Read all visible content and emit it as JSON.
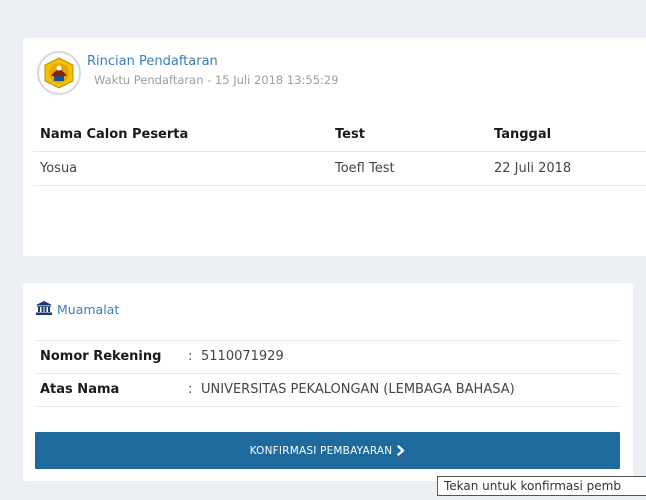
{
  "registration": {
    "title": "Rincian Pendaftaran",
    "time_text": "Waktu Pendaftaran - 15 Juli 2018 13:55:29",
    "columns": [
      "Nama Calon Peserta",
      "Test",
      "Tanggal"
    ],
    "rows": [
      [
        "Yosua",
        "Toefl Test",
        "22 Juli 2018"
      ]
    ]
  },
  "bank": {
    "icon": "bank-icon",
    "name": "Muamalat",
    "account_label": "Nomor Rekening",
    "account_value": "5110071929",
    "holder_label": "Atas Nama",
    "holder_value": "UNIVERSITAS PEKALONGAN (LEMBAGA BAHASA)",
    "colon": ":"
  },
  "confirm": {
    "label": "KONFIRMASI PEMBAYARAN",
    "icon": "chevron-right-icon",
    "color": "#1f6a9c"
  },
  "tooltip": {
    "text": "Tekan untuk konfirmasi pemb"
  },
  "colors": {
    "background": "#ecf0f4",
    "link": "#3a7cc0"
  }
}
